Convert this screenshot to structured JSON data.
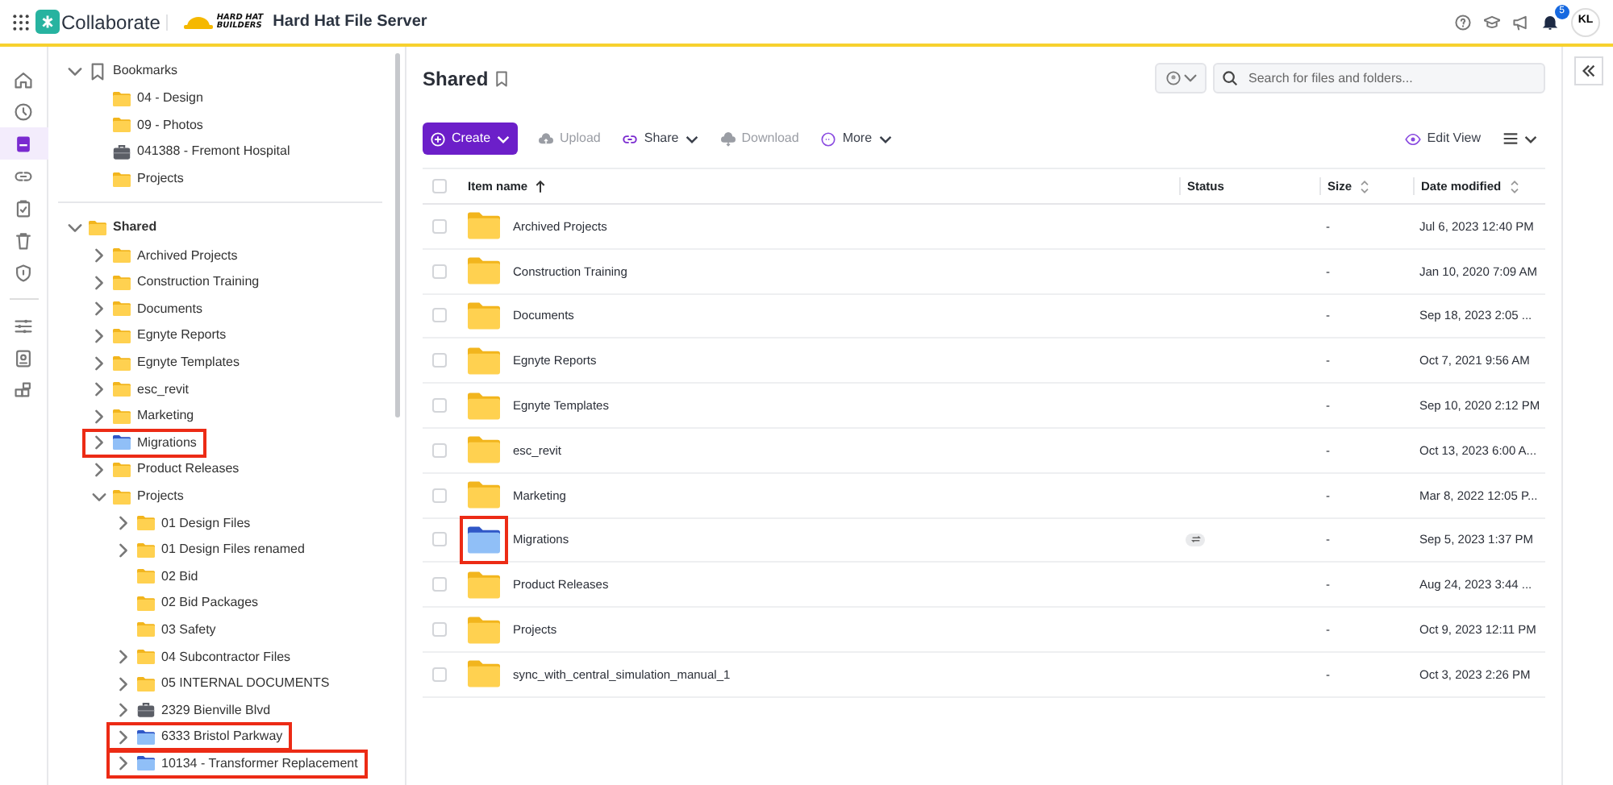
{
  "app": {
    "name": "Collaborate",
    "company_logo_lines": [
      "HARD HAT",
      "BUILDERS"
    ],
    "server": "Hard Hat File Server",
    "notifications": "5",
    "avatar": "KL"
  },
  "rail": [
    {
      "kind": "home",
      "selected": false,
      "divider_before": false
    },
    {
      "kind": "clock",
      "selected": false,
      "divider_before": false
    },
    {
      "kind": "box",
      "selected": true,
      "divider_before": false
    },
    {
      "kind": "link",
      "selected": false,
      "divider_before": false
    },
    {
      "kind": "clipboard",
      "selected": false,
      "divider_before": false
    },
    {
      "kind": "trash",
      "selected": false,
      "divider_before": false
    },
    {
      "kind": "shield",
      "selected": false,
      "divider_before": false
    },
    {
      "kind": "sliders",
      "selected": false,
      "divider_before": true
    },
    {
      "kind": "contact",
      "selected": false,
      "divider_before": false
    },
    {
      "kind": "blocks",
      "selected": false,
      "divider_before": false
    }
  ],
  "tree": [
    {
      "label": "Bookmarks",
      "kind": "bookmark",
      "expandable": true,
      "expanded": true,
      "bold": false,
      "children": [
        {
          "label": "04 - Design",
          "kind": "folder",
          "expandable": false
        },
        {
          "label": "09 - Photos",
          "kind": "folder",
          "expandable": false
        },
        {
          "label": "041388 - Fremont Hospital",
          "kind": "briefcase",
          "expandable": false
        },
        {
          "label": "Projects",
          "kind": "folder",
          "expandable": false
        }
      ]
    },
    {
      "label": "Shared",
      "kind": "folder",
      "expandable": true,
      "expanded": true,
      "bold": true,
      "children": [
        {
          "label": "Archived Projects",
          "kind": "folder",
          "expandable": true,
          "expanded": false
        },
        {
          "label": "Construction Training",
          "kind": "folder",
          "expandable": true,
          "expanded": false
        },
        {
          "label": "Documents",
          "kind": "folder",
          "expandable": true,
          "expanded": false
        },
        {
          "label": "Egnyte Reports",
          "kind": "folder",
          "expandable": true,
          "expanded": false
        },
        {
          "label": "Egnyte Templates",
          "kind": "folder",
          "expandable": true,
          "expanded": false
        },
        {
          "label": "esc_revit",
          "kind": "folder",
          "expandable": true,
          "expanded": false
        },
        {
          "label": "Marketing",
          "kind": "folder",
          "expandable": true,
          "expanded": false
        },
        {
          "label": "Migrations",
          "kind": "shared-folder",
          "expandable": true,
          "expanded": false,
          "highlighted": true
        },
        {
          "label": "Product Releases",
          "kind": "folder",
          "expandable": true,
          "expanded": false
        },
        {
          "label": "Projects",
          "kind": "folder",
          "expandable": true,
          "expanded": true,
          "children": [
            {
              "label": "01 Design Files",
              "kind": "folder",
              "expandable": true,
              "expanded": false
            },
            {
              "label": "01 Design Files renamed",
              "kind": "folder",
              "expandable": true,
              "expanded": false
            },
            {
              "label": "02 Bid",
              "kind": "folder",
              "expandable": false
            },
            {
              "label": "02 Bid Packages",
              "kind": "folder",
              "expandable": false
            },
            {
              "label": "03 Safety",
              "kind": "folder",
              "expandable": false
            },
            {
              "label": "04 Subcontractor Files",
              "kind": "folder",
              "expandable": true,
              "expanded": false
            },
            {
              "label": "05 INTERNAL DOCUMENTS",
              "kind": "folder",
              "expandable": true,
              "expanded": false
            },
            {
              "label": "2329 Bienville Blvd",
              "kind": "briefcase",
              "expandable": true,
              "expanded": false
            },
            {
              "label": "6333 Bristol Parkway",
              "kind": "shared-folder",
              "expandable": true,
              "expanded": false,
              "highlighted": true
            },
            {
              "label": "10134 - Transformer Replacement",
              "kind": "shared-folder",
              "expandable": true,
              "expanded": false,
              "highlighted": true
            }
          ]
        }
      ]
    }
  ],
  "main": {
    "title": "Shared",
    "search": {
      "placeholder": "Search for files and folders..."
    },
    "toolbar": [
      {
        "label": "Create",
        "kind": "create",
        "caret": true,
        "disabled": false
      },
      {
        "label": "Upload",
        "kind": "upload",
        "caret": false,
        "disabled": true
      },
      {
        "label": "Share",
        "kind": "share",
        "caret": true,
        "disabled": false
      },
      {
        "label": "Download",
        "kind": "download",
        "caret": false,
        "disabled": true
      },
      {
        "label": "More",
        "kind": "more",
        "caret": true,
        "disabled": false
      }
    ],
    "edit_view": "Edit View",
    "select_all_checked": false,
    "columns": [
      {
        "label": "Item name",
        "kind": "sorted-asc"
      },
      {
        "label": "Status",
        "kind": "plain"
      },
      {
        "label": "Size",
        "kind": "sortable"
      },
      {
        "label": "Date modified",
        "kind": "sortable"
      }
    ],
    "rows": [
      {
        "name": "Archived Projects",
        "kind": "folder",
        "checked": false,
        "synced": false,
        "size": "-",
        "date": "Jul 6, 2023 12:40 PM",
        "highlighted": false
      },
      {
        "name": "Construction Training",
        "kind": "folder",
        "checked": false,
        "synced": false,
        "size": "-",
        "date": "Jan 10, 2020 7:09 AM",
        "highlighted": false
      },
      {
        "name": "Documents",
        "kind": "folder",
        "checked": false,
        "synced": false,
        "size": "-",
        "date": "Sep 18, 2023 2:05 ...",
        "highlighted": false
      },
      {
        "name": "Egnyte Reports",
        "kind": "folder",
        "checked": false,
        "synced": false,
        "size": "-",
        "date": "Oct 7, 2021 9:56 AM",
        "highlighted": false
      },
      {
        "name": "Egnyte Templates",
        "kind": "folder",
        "checked": false,
        "synced": false,
        "size": "-",
        "date": "Sep 10, 2020 2:12 PM",
        "highlighted": false
      },
      {
        "name": "esc_revit",
        "kind": "folder",
        "checked": false,
        "synced": false,
        "size": "-",
        "date": "Oct 13, 2023 6:00 A...",
        "highlighted": false
      },
      {
        "name": "Marketing",
        "kind": "folder",
        "checked": false,
        "synced": false,
        "size": "-",
        "date": "Mar 8, 2022 12:05 P...",
        "highlighted": false
      },
      {
        "name": "Migrations",
        "kind": "shared-folder",
        "checked": false,
        "synced": true,
        "size": "-",
        "date": "Sep 5, 2023 1:37 PM",
        "highlighted": true
      },
      {
        "name": "Product Releases",
        "kind": "folder",
        "checked": false,
        "synced": false,
        "size": "-",
        "date": "Aug 24, 2023 3:44 ...",
        "highlighted": false
      },
      {
        "name": "Projects",
        "kind": "folder",
        "checked": false,
        "synced": false,
        "size": "-",
        "date": "Oct 9, 2023 12:11 PM",
        "highlighted": false
      },
      {
        "name": "sync_with_central_simulation_manual_1",
        "kind": "folder",
        "checked": false,
        "synced": false,
        "size": "-",
        "date": "Oct 3, 2023 2:26 PM",
        "highlighted": false
      }
    ]
  }
}
